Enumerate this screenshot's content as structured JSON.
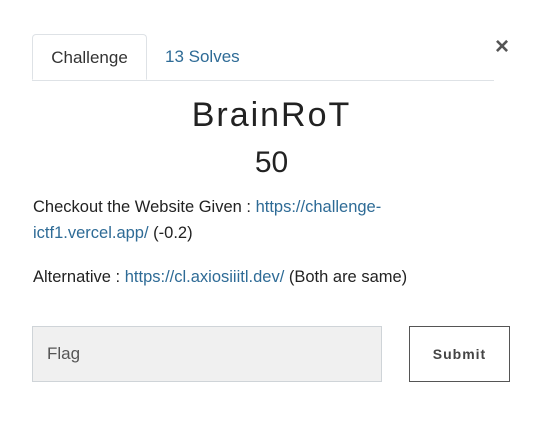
{
  "modal": {
    "close_glyph": "×",
    "tabs": [
      {
        "label": "Challenge"
      },
      {
        "label": "13 Solves"
      }
    ],
    "challenge": {
      "name": "BrainRoT",
      "points": "50",
      "desc_line1_prefix": "Checkout the Website Given : ",
      "desc_line1_link": "https://challenge-ictf1.vercel.app/",
      "desc_line1_suffix": " (-0.2)",
      "desc_line2_prefix": "Alternative : ",
      "desc_line2_link": "https://cl.axiosiiitl.dev/",
      "desc_line2_suffix": " (Both are same)"
    },
    "form": {
      "flag_placeholder": "Flag",
      "submit_label": "Submit"
    }
  },
  "colors": {
    "link": "#2e6b96",
    "input_bg": "#f0f0f0"
  },
  "icons": {
    "close": "close-icon"
  }
}
